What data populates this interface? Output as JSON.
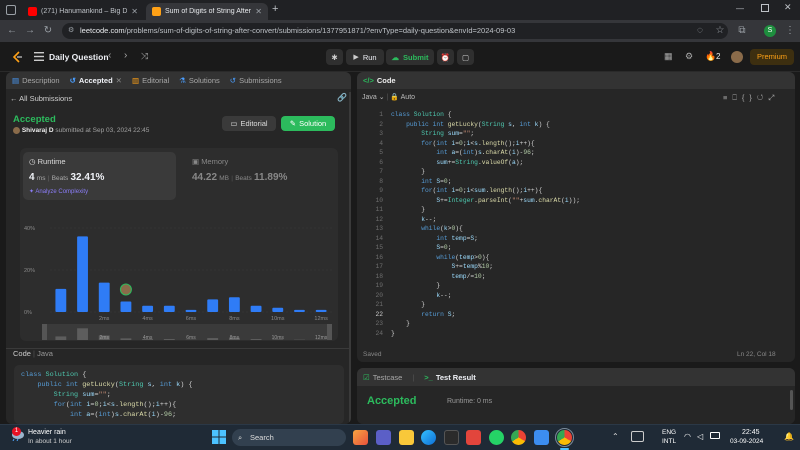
{
  "browser": {
    "tabs": [
      {
        "title": "(271) Hanumankind – Big Dawɡ",
        "icon_color": "#ff0000",
        "icon": "youtube-icon"
      },
      {
        "title": "Sum of Digits of String After Co",
        "icon_color": "#ffa116",
        "icon": "leetcode-icon"
      }
    ],
    "url_host": "leetcode.com",
    "url_path": "/problems/sum-of-digits-of-string-after-convert/submissions/1377951871/?envType=daily-question&envId=2024-09-03",
    "profile_initial": "S"
  },
  "nav": {
    "daily_question": "Daily Question",
    "run_label": "Run",
    "submit_label": "Submit",
    "streak_count": "2",
    "premium_label": "Premium"
  },
  "left_panel": {
    "tabs": [
      "Description",
      "Accepted",
      "Editorial",
      "Solutions",
      "Submissions"
    ],
    "all_submissions": "All Submissions",
    "status": "Accepted",
    "author": "Shivaraj D",
    "submitted_text": "submitted at Sep 03, 2024 22:45",
    "editorial_btn": "Editorial",
    "solution_btn": "Solution",
    "runtime": {
      "label": "Runtime",
      "value": "4",
      "unit": "ms",
      "beats_label": "Beats",
      "beats": "32.41%",
      "analyze": "Analyze Complexity"
    },
    "memory": {
      "label": "Memory",
      "value": "44.22",
      "unit": "MB",
      "beats_label": "Beats",
      "beats": "11.89%"
    },
    "code_label": "Code",
    "code_lang": "Java",
    "code_preview": [
      "class Solution {",
      "    public int getLucky(String s, int k) {",
      "        String sum=\"\";",
      "        for(int i=0;i<s.length();i++){",
      "            int a=(int)s.charAt(i)-96;"
    ]
  },
  "chart_data": {
    "type": "bar",
    "yticks": [
      "40%",
      "20%",
      "0%"
    ],
    "xticks": [
      "2ms",
      "4ms",
      "6ms",
      "8ms",
      "10ms",
      "12ms"
    ],
    "values": [
      11,
      36,
      14,
      5,
      3,
      3,
      1,
      6,
      7,
      3,
      2,
      1,
      1
    ],
    "ylim": [
      0,
      40
    ],
    "highlight_index": 3,
    "bar_color": "#2f7cf6"
  },
  "editor": {
    "title": "Code",
    "language": "Java",
    "mode": "Auto",
    "saved": "Saved",
    "cursor": "Ln 22, Col 18",
    "line_numbers": [
      "1",
      "2",
      "3",
      "4",
      "5",
      "6",
      "7",
      "8",
      "9",
      "10",
      "11",
      "12",
      "13",
      "14",
      "15",
      "16",
      "17",
      "18",
      "19",
      "20",
      "21",
      "22",
      "23",
      "24"
    ]
  },
  "bottom_panel": {
    "tab_testcase": "Testcase",
    "tab_result": "Test Result",
    "status": "Accepted",
    "runtime": "Runtime: 0 ms"
  },
  "taskbar": {
    "weather_title": "Heavier rain",
    "weather_sub": "In about 1 hour",
    "search": "Search",
    "lang1": "ENG",
    "lang2": "INTL",
    "time": "22:45",
    "date": "03-09-2024",
    "badge": "1"
  }
}
